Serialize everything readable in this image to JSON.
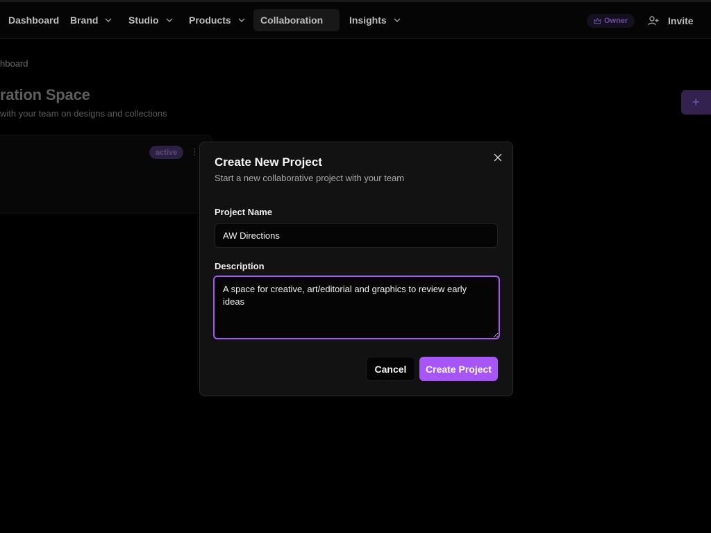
{
  "nav": {
    "items": [
      {
        "label": "Dashboard",
        "has_dropdown": false
      },
      {
        "label": "Brand",
        "has_dropdown": true
      },
      {
        "label": "Studio",
        "has_dropdown": true
      },
      {
        "label": "Products",
        "has_dropdown": true
      },
      {
        "label": "Collaboration",
        "has_dropdown": false,
        "active": true
      },
      {
        "label": "Insights",
        "has_dropdown": true
      }
    ],
    "owner_badge": "Owner",
    "invite_label": "Invite"
  },
  "page": {
    "breadcrumb": "hboard",
    "title": "ration Space",
    "subtitle": "with your team on designs and collections",
    "add_button_icon": "+",
    "card": {
      "status": "active",
      "menu_icon": "⋮"
    }
  },
  "modal": {
    "title": "Create New Project",
    "subtitle": "Start a new collaborative project with your team",
    "close_icon": "close-icon",
    "name_label": "Project Name",
    "name_value": "AW Directions",
    "description_label": "Description",
    "description_value": "A space for creative, art/editorial and graphics to review early ideas",
    "cancel_label": "Cancel",
    "create_label": "Create Project"
  },
  "colors": {
    "accent": "#a855f7",
    "background": "#000000",
    "modal_bg": "#121212"
  }
}
